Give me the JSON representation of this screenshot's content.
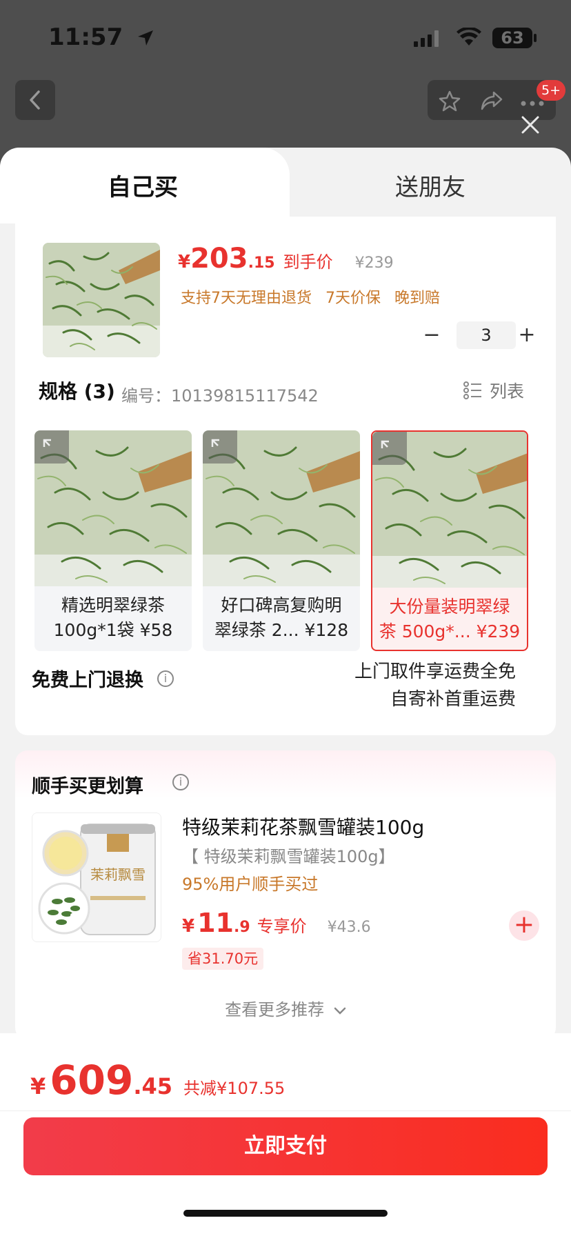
{
  "status": {
    "time": "11:57",
    "battery": "63"
  },
  "nav": {
    "badge": "5+"
  },
  "tabs": {
    "self": "自己买",
    "gift": "送朋友"
  },
  "product": {
    "price_currency": "¥",
    "price_int": "203",
    "price_dec": ".15",
    "price_label": "到手价",
    "original_price": "¥239",
    "services": [
      "支持7天无理由退货",
      "7天价保",
      "晚到赔"
    ],
    "quantity": "3"
  },
  "spec": {
    "title": "规格 (3)",
    "code": "编号：10139815117542",
    "list_label": "列表",
    "options": [
      {
        "line1": "精选明翠绿茶",
        "line2": "100g*1袋 ¥58",
        "selected": false
      },
      {
        "line1": "好口碑高复购明",
        "line2": "翠绿茶 2... ¥128",
        "selected": false
      },
      {
        "line1": "大份量装明翠绿",
        "line2": "茶 500g*... ¥239",
        "selected": true
      }
    ]
  },
  "free_return": {
    "title": "免费上门退换",
    "line1": "上门取件享运费全免",
    "line2": "自寄补首重运费"
  },
  "addon": {
    "title": "顺手买更划算",
    "name": "特级茉莉花茶飘雪罐装100g",
    "spec": "【 特级茉莉飘雪罐装100g】",
    "buy_rate": "95%用户顺手买过",
    "price_currency": "¥",
    "price_int": "11",
    "price_dec": ".9",
    "price_label": "专享价",
    "original_price": "¥43.6",
    "save": "省31.70元",
    "add": "+",
    "more": "查看更多推荐"
  },
  "footer": {
    "currency": "¥",
    "total_int": "609",
    "total_dec": ".45",
    "saved": "共减¥107.55",
    "pay_label": "立即支付"
  },
  "colors": {
    "accent": "#e8322e",
    "service": "#c8782a"
  }
}
